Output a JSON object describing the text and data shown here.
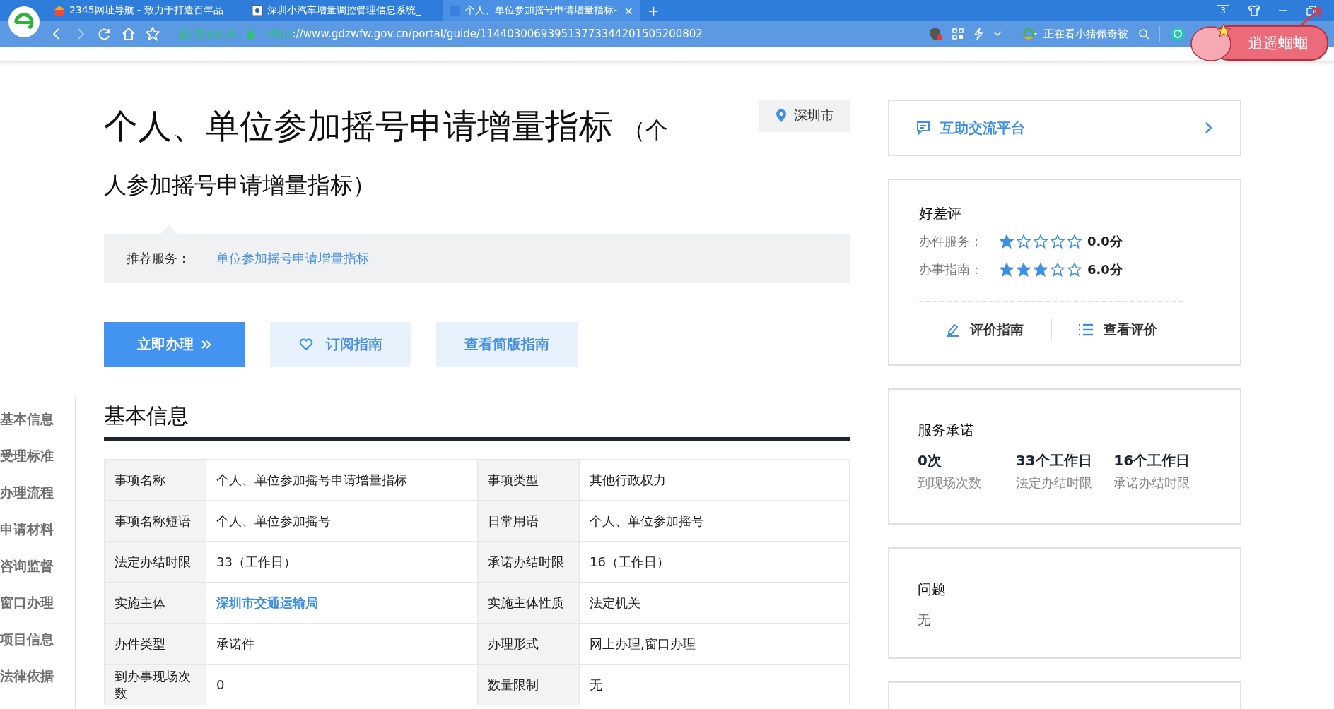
{
  "browser": {
    "tabs": [
      {
        "title": "2345网址导航 - 致力于打造百年品",
        "selected": false
      },
      {
        "title": "深圳小汽车增量调控管理信息系统_",
        "selected": false
      },
      {
        "title": "个人、单位参加摇号申请增量指标-",
        "selected": true
      }
    ],
    "tab_count": "3",
    "close": "×",
    "new_tab": "+",
    "address": {
      "badge": "党政机关",
      "scheme": "https",
      "rest": "://www.gdzwfw.gov.cn/portal/guide/114403006939513773344201505200802"
    },
    "news": "正在看小猪佩奇被",
    "sticker": "逍遥蝈蝈"
  },
  "sidebar": {
    "items": [
      {
        "label": "基本信息"
      },
      {
        "label": "受理标准"
      },
      {
        "label": "办理流程"
      },
      {
        "label": "申请材料"
      },
      {
        "label": "咨询监督"
      },
      {
        "label": "窗口办理"
      },
      {
        "label": "项目信息"
      },
      {
        "label": "法律依据"
      }
    ]
  },
  "guide": {
    "title": "个人、单位参加摇号申请增量指标",
    "subtitle": "（个人参加摇号申请增量指标）",
    "location": "深圳市",
    "recommend": {
      "label": "推荐服务：",
      "link": "单位参加摇号申请增量指标"
    },
    "buttons": [
      {
        "label": "立即办理",
        "kind": "primary"
      },
      {
        "label": "订阅指南",
        "kind": "subscribe"
      },
      {
        "label": "查看简版指南",
        "kind": "plain"
      }
    ],
    "section_title": "基本信息",
    "table": {
      "rows": [
        {
          "cells": [
            {
              "text": "事项名称",
              "kind": "label"
            },
            {
              "text": "个人、单位参加摇号申请增量指标",
              "kind": "value"
            },
            {
              "text": "事项类型",
              "kind": "label"
            },
            {
              "text": "其他行政权力",
              "kind": "value"
            }
          ]
        },
        {
          "cells": [
            {
              "text": "事项名称短语",
              "kind": "label"
            },
            {
              "text": "个人、单位参加摇号",
              "kind": "value"
            },
            {
              "text": "日常用语",
              "kind": "label"
            },
            {
              "text": "个人、单位参加摇号",
              "kind": "value"
            }
          ]
        },
        {
          "cells": [
            {
              "text": "法定办结时限",
              "kind": "label"
            },
            {
              "text": "33（工作日）",
              "kind": "value"
            },
            {
              "text": "承诺办结时限",
              "kind": "label"
            },
            {
              "text": "16（工作日）",
              "kind": "value"
            }
          ]
        },
        {
          "cells": [
            {
              "text": "实施主体",
              "kind": "label"
            },
            {
              "text": "深圳市交通运输局",
              "kind": "link"
            },
            {
              "text": "实施主体性质",
              "kind": "label"
            },
            {
              "text": "法定机关",
              "kind": "value"
            }
          ]
        },
        {
          "cells": [
            {
              "text": "办件类型",
              "kind": "label"
            },
            {
              "text": "承诺件",
              "kind": "value"
            },
            {
              "text": "办理形式",
              "kind": "label"
            },
            {
              "text": "网上办理,窗口办理",
              "kind": "value"
            }
          ]
        },
        {
          "cells": [
            {
              "text": "到办事现场次数",
              "kind": "label"
            },
            {
              "text": "0",
              "kind": "value"
            },
            {
              "text": "数量限制",
              "kind": "label"
            },
            {
              "text": "无",
              "kind": "value"
            }
          ]
        }
      ]
    }
  },
  "community": {
    "title": "互助交流平台"
  },
  "ratings": {
    "title": "好差评",
    "rows": [
      {
        "label": "办件服务：",
        "stars": 1,
        "score": "0.0分"
      },
      {
        "label": "办事指南：",
        "stars": 3,
        "score": "6.0分"
      }
    ],
    "actions": [
      {
        "label": "评价指南",
        "kind": "edit"
      },
      {
        "label": "查看评价",
        "kind": "list"
      }
    ]
  },
  "promise": {
    "title": "服务承诺",
    "items": [
      {
        "value": "0次",
        "label": "到现场次数"
      },
      {
        "value": "33个工作日",
        "label": "法定办结时限"
      },
      {
        "value": "16个工作日",
        "label": "承诺办结时限"
      }
    ]
  },
  "issue": {
    "title": "问题",
    "text": "无"
  }
}
